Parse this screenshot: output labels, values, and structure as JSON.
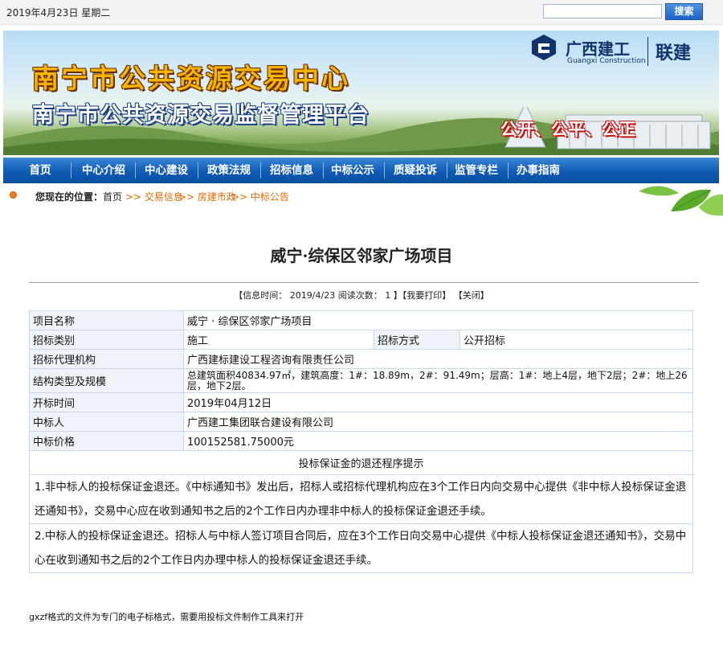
{
  "topbar": {
    "date": "2019年4月23日 星期二",
    "search_placeholder": "",
    "search_button": "搜索"
  },
  "banner": {
    "title_main": "南宁市公共资源交易中心",
    "title_sub": "南宁市公共资源交易监督管理平台",
    "slogan": "公开、公平、公正",
    "logo_cn": "广西建工",
    "logo_en": "Guangxi Construction",
    "logo_lj": "联建"
  },
  "nav": {
    "items": [
      {
        "label": "首页"
      },
      {
        "label": "中心介绍"
      },
      {
        "label": "中心建设"
      },
      {
        "label": "政策法规"
      },
      {
        "label": "招标信息"
      },
      {
        "label": "中标公示"
      },
      {
        "label": "质疑投诉"
      },
      {
        "label": "监管专栏"
      },
      {
        "label": "办事指南"
      }
    ]
  },
  "breadcrumb": {
    "label": "您现在的位置：",
    "home": "首页",
    "links": [
      ">> 交易信息",
      ">> 房建市政",
      ">> 中标公告"
    ]
  },
  "article": {
    "title": "威宁·综保区邻家广场项目",
    "meta": {
      "prefix": "【信息时间：",
      "date": "2019/4/23",
      "views_label": "阅读次数：",
      "views": "1",
      "print": "】【我要打印】",
      "close": "【关闭】"
    },
    "rows": {
      "name": {
        "label": "项目名称",
        "value": "威宁 · 综保区邻家广场项目"
      },
      "type": {
        "label": "招标类别",
        "value": "施工",
        "label2": "招标方式",
        "value2": "公开招标"
      },
      "agency": {
        "label": "招标代理机构",
        "value": "广西建标建设工程咨询有限责任公司"
      },
      "structure": {
        "label": "结构类型及规模",
        "value": "总建筑面积40834.97㎡，建筑高度：1#：18.89m，2#：91.49m；层高：1#：地上4层，地下2层；2#：地上26层，地下2层。"
      },
      "open_time": {
        "label": "开标时间",
        "value": "2019年04月12日"
      },
      "winner": {
        "label": "中标人",
        "value": "广西建工集团联合建设有限公司"
      },
      "price": {
        "label": "中标价格",
        "value": "100152581.75000元"
      }
    },
    "notice_title": "投标保证金的退还程序提示",
    "notice_1": "1.非中标人的投标保证金退还。《中标通知书》发出后，招标人或招标代理机构应在3个工作日内向交易中心提供《非中标人投标保证金退还通知书》，交易中心应在收到通知书之后的2个工作日内办理非中标人的投标保证金退还手续。",
    "notice_2": "2.中标人的投标保证金退还。招标人与中标人签订项目合同后，应在3个工作日向交易中心提供《中标人投标保证金退还通知书》，交易中心在收到通知书之后的2个工作日内办理中标人的投标保证金退还手续。"
  },
  "footer": {
    "note": "gxzf格式的文件为专门的电子标格式，需要用投标文件制作工具来打开"
  },
  "colors": {
    "nav": "#0f5bb5",
    "link": "#e06a00",
    "title_yellow": "#f4b400",
    "slogan_red": "#c4130f"
  }
}
